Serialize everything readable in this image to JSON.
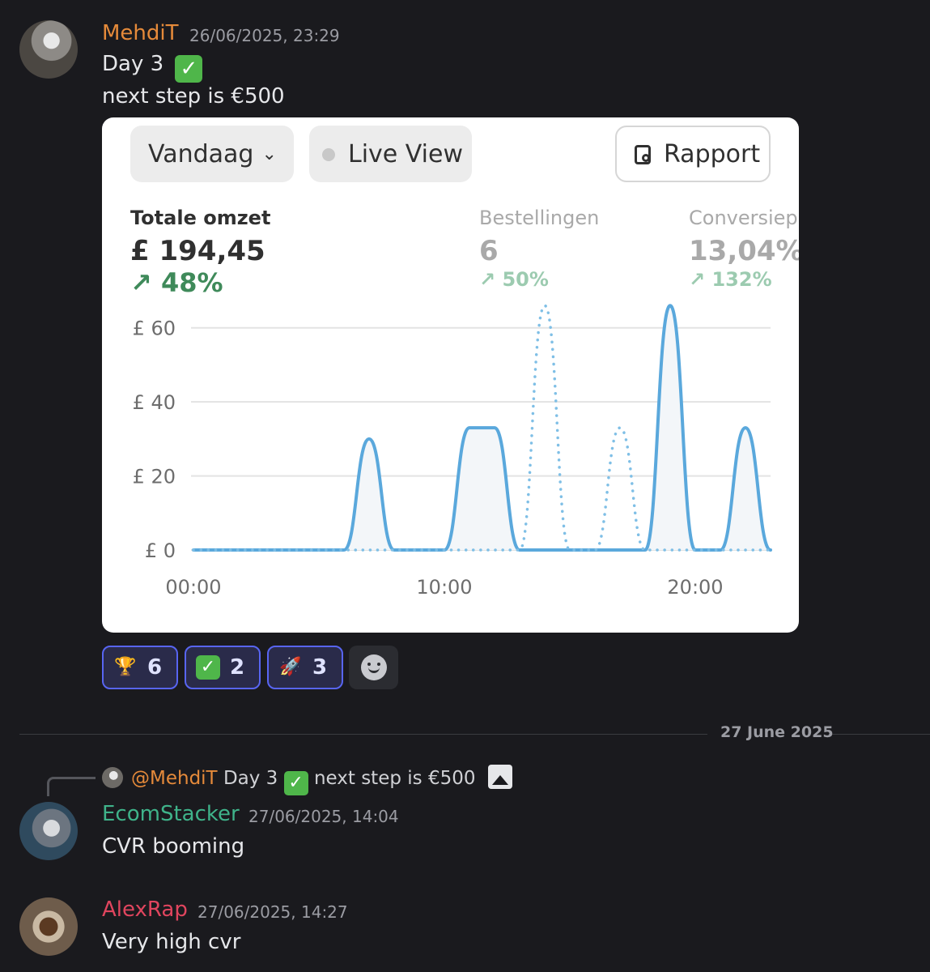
{
  "messages": [
    {
      "username": "MehdiT",
      "username_color": "#e58a3a",
      "timestamp": "26/06/2025, 23:29",
      "line1": "Day 3",
      "line2": "next step is €500"
    },
    {
      "username": "EcomStacker",
      "username_color": "#3fb38a",
      "timestamp": "27/06/2025, 14:04",
      "text": "CVR booming"
    },
    {
      "username": "AlexRap",
      "username_color": "#e0455e",
      "timestamp": "27/06/2025, 14:27",
      "text": "Very high cvr"
    }
  ],
  "embed": {
    "period_label": "Vandaag",
    "live_label": "Live View",
    "report_label": "Rapport",
    "metrics": [
      {
        "label": "Totale omzet",
        "value": "£ 194,45",
        "change": "48%",
        "change_color": "#3f8a5a"
      },
      {
        "label": "Bestellingen",
        "value": "6",
        "change": "50%",
        "change_color": "#9ccbb0"
      },
      {
        "label": "Conversiep",
        "value": "13,04%",
        "change": "132%",
        "change_color": "#9ccbb0"
      }
    ]
  },
  "chart_data": {
    "type": "line",
    "y_ticks": [
      "£ 60",
      "£ 40",
      "£ 20",
      "£ 0"
    ],
    "x_ticks": [
      "00:00",
      "10:00",
      "20:00"
    ],
    "ylim": [
      0,
      70
    ],
    "series": [
      {
        "style": "solid",
        "color": "#5aa8dc",
        "points": [
          [
            0,
            0
          ],
          [
            6,
            0
          ],
          [
            7,
            30
          ],
          [
            8,
            0
          ],
          [
            10,
            0
          ],
          [
            11,
            33
          ],
          [
            12,
            33
          ],
          [
            13,
            0
          ],
          [
            18,
            0
          ],
          [
            19,
            66
          ],
          [
            20,
            0
          ],
          [
            21,
            0
          ],
          [
            22,
            33
          ],
          [
            23,
            0
          ]
        ]
      },
      {
        "style": "dotted",
        "color": "#7fbfe6",
        "points": [
          [
            0,
            0
          ],
          [
            13,
            0
          ],
          [
            14,
            66
          ],
          [
            15,
            0
          ],
          [
            16,
            0
          ],
          [
            17,
            33
          ],
          [
            18,
            0
          ],
          [
            23,
            0
          ]
        ]
      }
    ]
  },
  "reactions": [
    {
      "emoji": "🏆",
      "count": "6"
    },
    {
      "emoji": "✅",
      "count": "2"
    },
    {
      "emoji": "🚀",
      "count": "3"
    }
  ],
  "date_separator": "27 June 2025",
  "reply": {
    "mention": "@MehdiT",
    "text_before": "Day 3",
    "text_after": "next step is €500"
  }
}
